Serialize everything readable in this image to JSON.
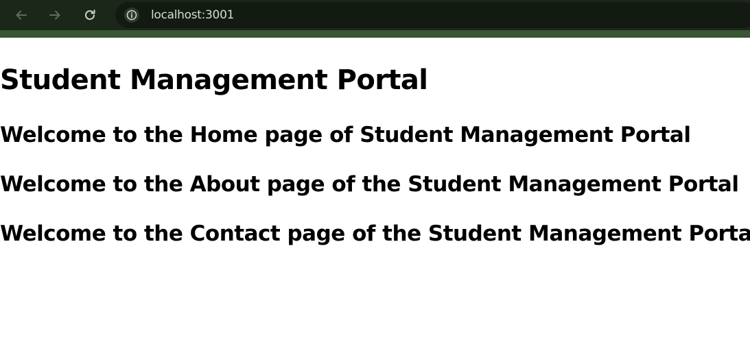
{
  "browser": {
    "url": "localhost:3001",
    "icons": {
      "back": "arrow-left-icon",
      "forward": "arrow-right-icon",
      "reload": "reload-icon",
      "site_info": "info-icon"
    },
    "colors": {
      "toolbar": "#1b2819",
      "toolbar_border": "#3a5436",
      "address_bar": "#121a11"
    }
  },
  "page": {
    "title": "Student Management Portal",
    "sections": [
      "Welcome to the Home page of Student Management Portal",
      "Welcome to the About page of the Student Management Portal",
      "Welcome to the Contact page of the Student Management Portal"
    ]
  }
}
